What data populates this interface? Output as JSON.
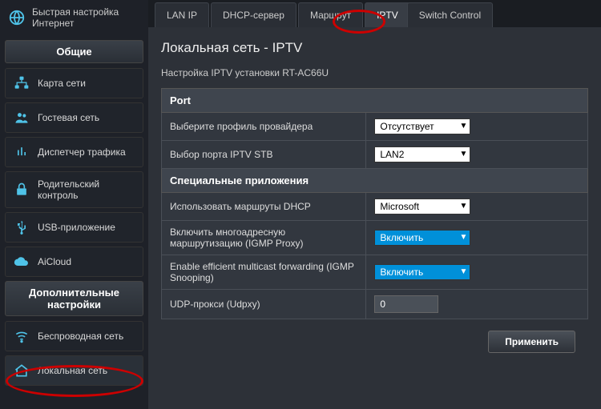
{
  "sidebar": {
    "top_label": "Быстрая настройка\nИнтернет",
    "general_head": "Общие",
    "general": [
      {
        "label": "Карта сети"
      },
      {
        "label": "Гостевая сеть"
      },
      {
        "label": "Диспетчер трафика"
      },
      {
        "label": "Родительский контроль"
      },
      {
        "label": "USB-приложение"
      },
      {
        "label": "AiCloud"
      }
    ],
    "advanced_head": "Дополнительные настройки",
    "advanced": [
      {
        "label": "Беспроводная сеть"
      },
      {
        "label": "Локальная сеть"
      }
    ]
  },
  "tabs": [
    "LAN IP",
    "DHCP-сервер",
    "Маршрут",
    "IPTV",
    "Switch Control"
  ],
  "active_tab": 3,
  "page": {
    "title": "Локальная сеть - IPTV",
    "subtitle": "Настройка IPTV установки RT-AC66U",
    "group_port": "Port",
    "group_special": "Специальные приложения",
    "rows": {
      "provider_profile": {
        "label": "Выберите профиль провайдера",
        "value": "Отсутствует"
      },
      "iptv_port": {
        "label": "Выбор порта IPTV STB",
        "value": "LAN2"
      },
      "dhcp_routes": {
        "label": "Использовать маршруты DHCP",
        "value": "Microsoft"
      },
      "igmp_proxy": {
        "label": "Включить многоадресную маршрутизацию (IGMP Proxy)",
        "value": "Включить"
      },
      "igmp_snoop": {
        "label": "Enable efficient multicast forwarding (IGMP Snooping)",
        "value": "Включить"
      },
      "udpxy": {
        "label": "UDP-прокси (Udpxy)",
        "value": "0"
      }
    },
    "apply": "Применить"
  }
}
